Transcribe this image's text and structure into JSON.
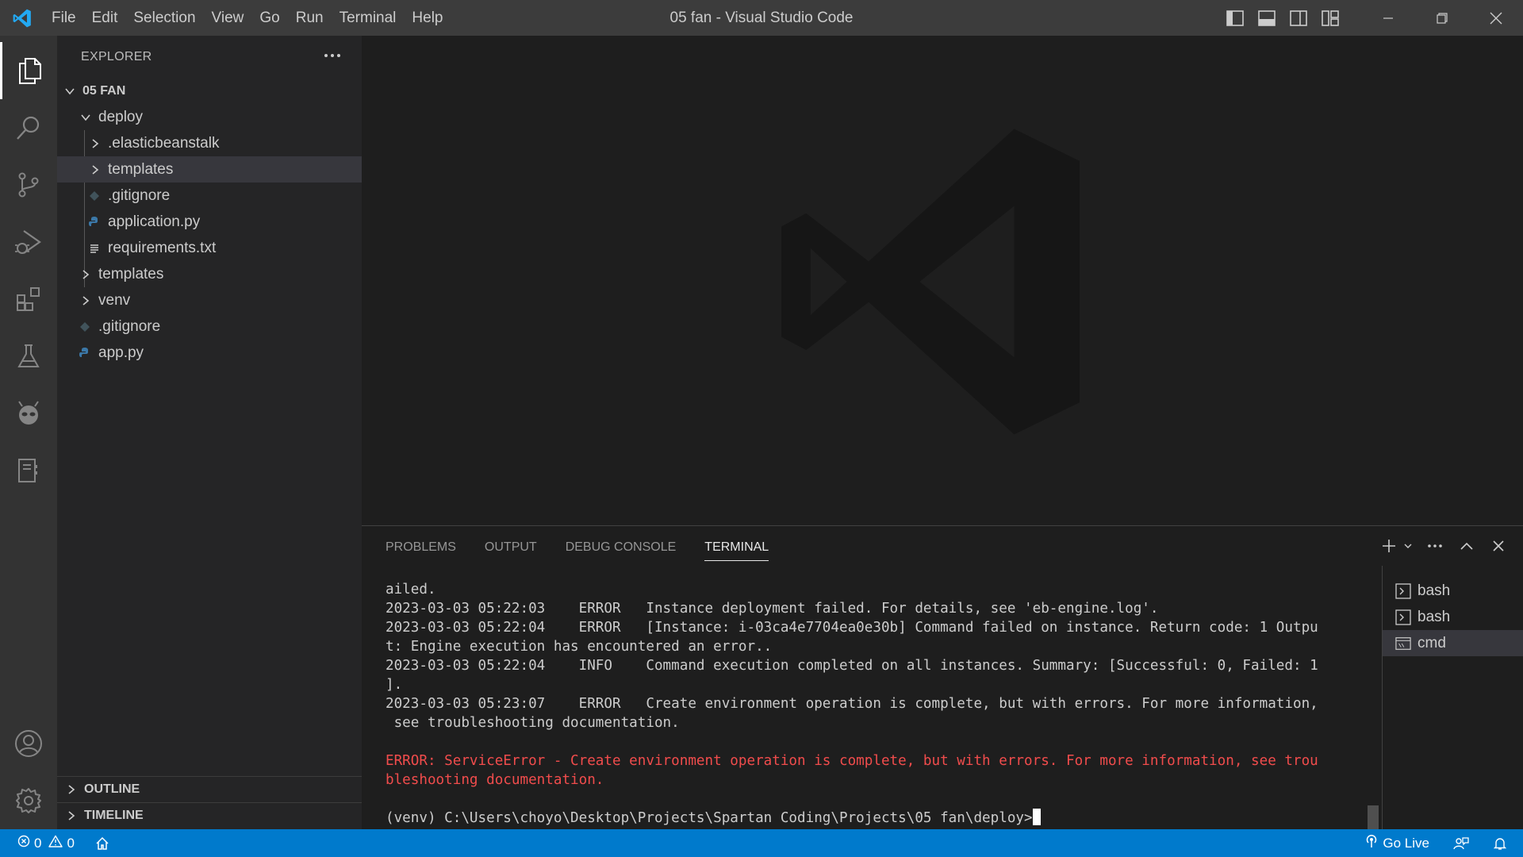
{
  "window": {
    "title": "05 fan - Visual Studio Code"
  },
  "menu": [
    "File",
    "Edit",
    "Selection",
    "View",
    "Go",
    "Run",
    "Terminal",
    "Help"
  ],
  "sidebar": {
    "header": "EXPLORER",
    "root": "05 FAN",
    "tree": [
      {
        "label": "deploy",
        "kind": "folder-open"
      },
      {
        "label": ".elasticbeanstalk",
        "kind": "folder"
      },
      {
        "label": "templates",
        "kind": "folder"
      },
      {
        "label": ".gitignore",
        "kind": "git"
      },
      {
        "label": "application.py",
        "kind": "python"
      },
      {
        "label": "requirements.txt",
        "kind": "text"
      },
      {
        "label": "templates",
        "kind": "folder"
      },
      {
        "label": "venv",
        "kind": "folder"
      },
      {
        "label": ".gitignore",
        "kind": "git"
      },
      {
        "label": "app.py",
        "kind": "python"
      }
    ],
    "outline": "OUTLINE",
    "timeline": "TIMELINE"
  },
  "panel": {
    "tabs": [
      "PROBLEMS",
      "OUTPUT",
      "DEBUG CONSOLE",
      "TERMINAL"
    ],
    "active_tab": "TERMINAL",
    "terminal_lines": [
      "ailed.",
      "2023-03-03 05:22:03    ERROR   Instance deployment failed. For details, see 'eb-engine.log'.",
      "2023-03-03 05:22:04    ERROR   [Instance: i-03ca4e7704ea0e30b] Command failed on instance. Return code: 1 Outpu",
      "t: Engine execution has encountered an error..",
      "2023-03-03 05:22:04    INFO    Command execution completed on all instances. Summary: [Successful: 0, Failed: 1",
      "].",
      "2023-03-03 05:23:07    ERROR   Create environment operation is complete, but with errors. For more information,",
      " see troubleshooting documentation.",
      ""
    ],
    "error_lines": [
      "ERROR: ServiceError - Create environment operation is complete, but with errors. For more information, see trou",
      "bleshooting documentation."
    ],
    "prompt": "(venv) C:\\Users\\choyo\\Desktop\\Projects\\Spartan Coding\\Projects\\05 fan\\deploy>",
    "terminals": [
      "bash",
      "bash",
      "cmd"
    ],
    "active_terminal": "cmd"
  },
  "statusbar": {
    "errors": "0",
    "warnings": "0",
    "go_live": "Go Live"
  },
  "colors": {
    "accent": "#007acc",
    "error": "#f14c4c",
    "logo": "#23a9f2"
  }
}
